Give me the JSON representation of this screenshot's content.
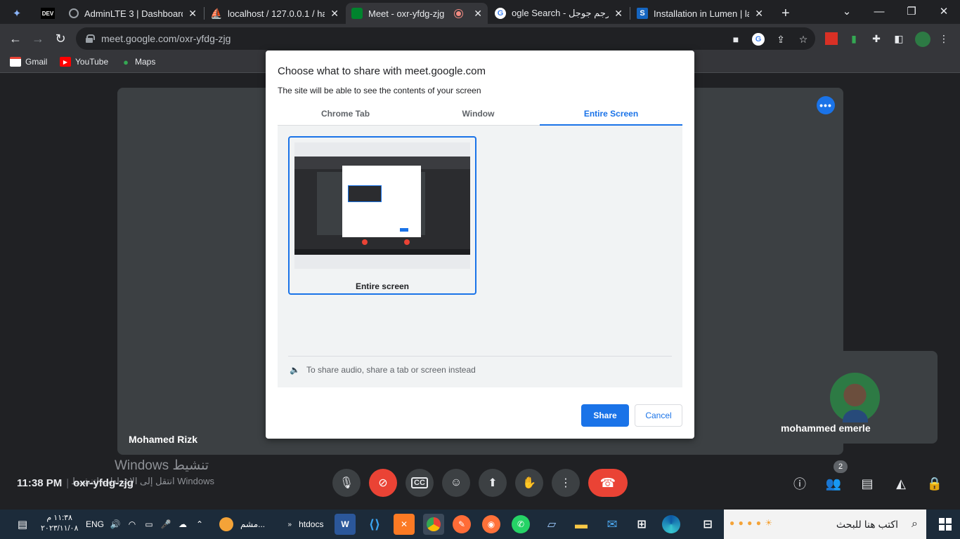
{
  "browser": {
    "tabs": [
      {
        "title": "",
        "icon": "gemini-icon"
      },
      {
        "title": "",
        "icon": "dev-icon",
        "icon_text": "DEV"
      },
      {
        "title": "AdminLTE 3 | Dashboard",
        "icon": "globe-icon"
      },
      {
        "title": "localhost / 127.0.0.1 / har",
        "icon": "phpmyadmin-icon"
      },
      {
        "title": "Meet - oxr-yfdg-zjg",
        "icon": "meet-icon"
      },
      {
        "title": "ogle Search - مترجم جوجل",
        "icon": "google-icon"
      },
      {
        "title": "Installation in Lumen | lar",
        "icon": "s-icon",
        "icon_text": "S"
      }
    ],
    "url": "meet.google.com/oxr-yfdg-zjg",
    "bookmarks": [
      {
        "label": "Gmail"
      },
      {
        "label": "YouTube"
      },
      {
        "label": "Maps"
      }
    ]
  },
  "meet": {
    "presenter_name": "Mohamed Rizk",
    "self_name": "mohammed emerle",
    "time": "11:38 PM",
    "meeting_code": "oxr-yfdg-zjg",
    "participants_count": "2",
    "watermark_title": "Windows تنشيط",
    "watermark_sub": "انتقل إلى الإعدادات لتنشيط Windows"
  },
  "dialog": {
    "title": "Choose what to share with meet.google.com",
    "subtitle": "The site will be able to see the contents of your screen",
    "tabs": [
      "Chrome Tab",
      "Window",
      "Entire Screen"
    ],
    "active_tab": "Entire Screen",
    "screen_label": "Entire screen",
    "audio_note": "To share audio, share a tab or screen instead",
    "share_label": "Share",
    "cancel_label": "Cancel"
  },
  "taskbar": {
    "search_placeholder": "اكتب هنا للبحث",
    "htdocs_label": "htdocs",
    "chat_label": "مشم...",
    "lang": "ENG",
    "clock_time": "١١:٣٨ م",
    "clock_date": "٢٠٢٣/١١/٠٨"
  },
  "colors": {
    "accent": "#1a73e8",
    "end_call": "#ea4335",
    "background": "#202124"
  }
}
